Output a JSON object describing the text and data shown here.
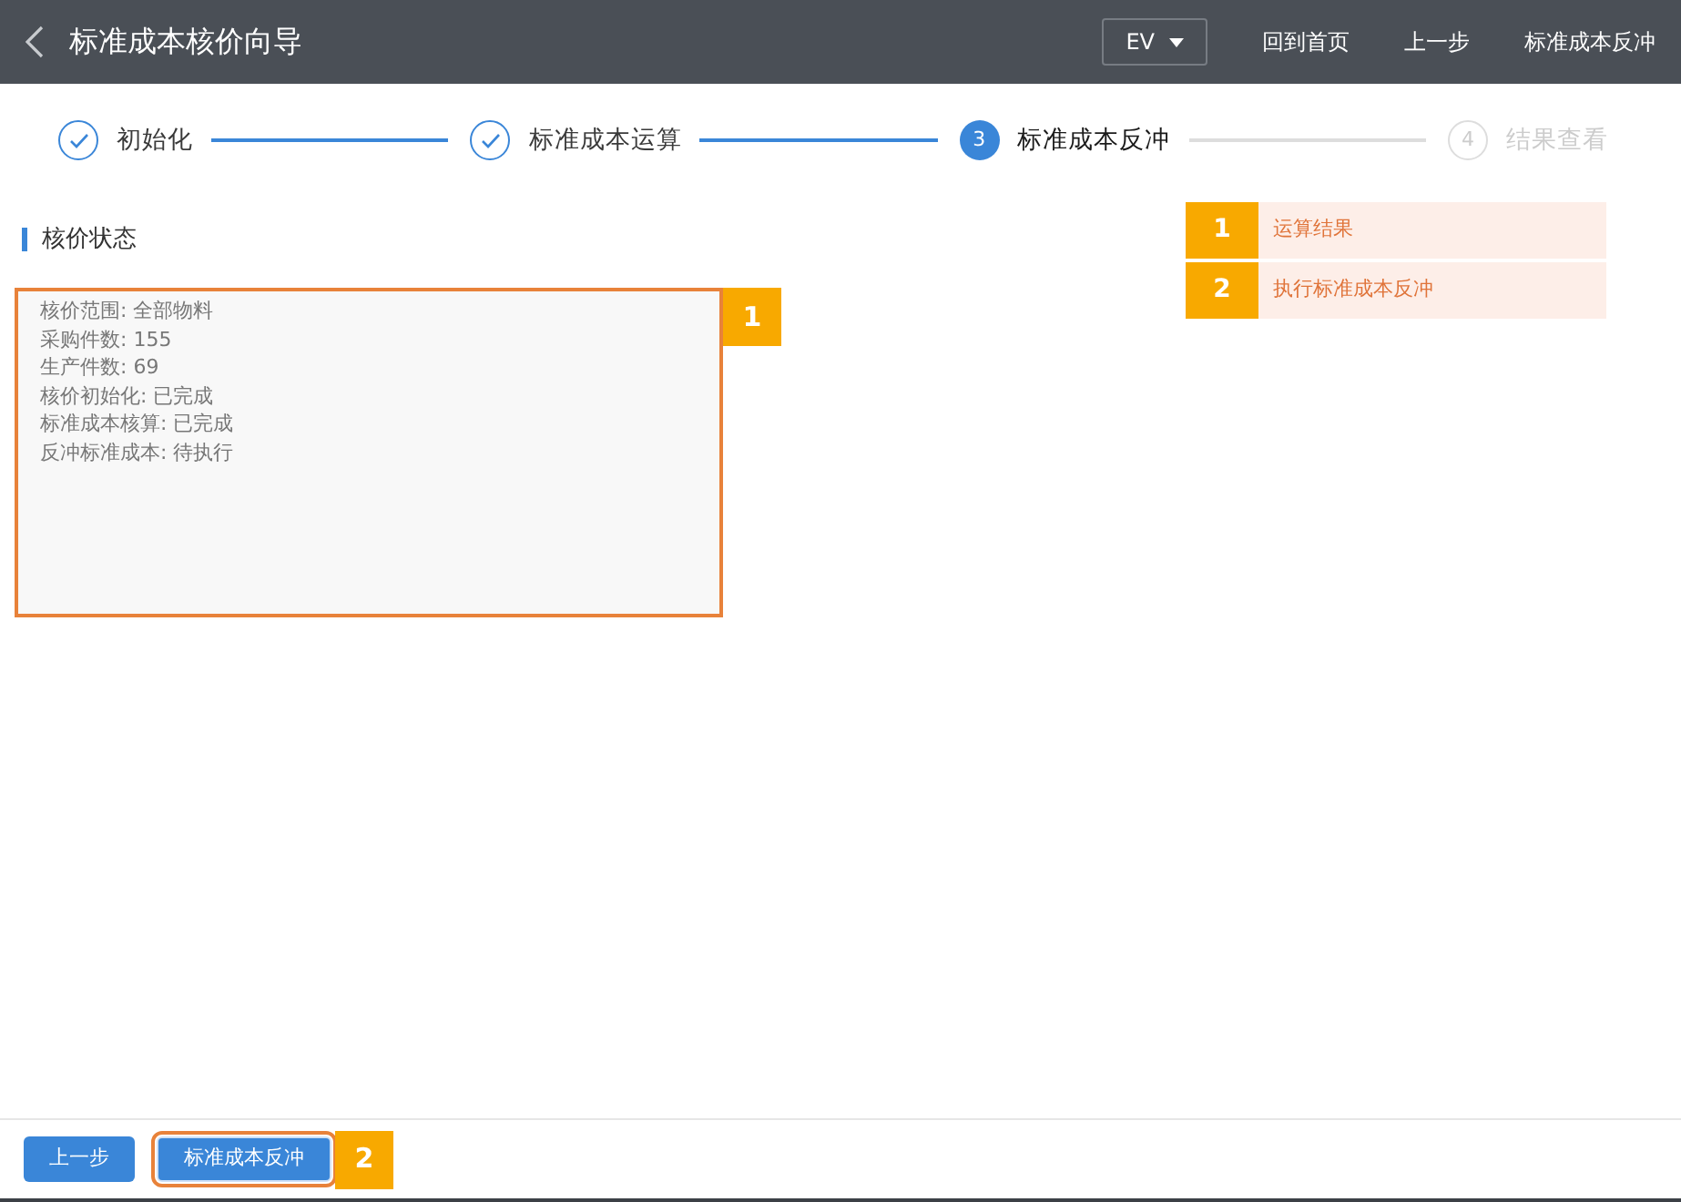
{
  "header": {
    "title": "标准成本核价向导",
    "lang_select": "EV",
    "actions": [
      "回到首页",
      "上一步",
      "标准成本反冲"
    ]
  },
  "steps": [
    {
      "label": "初始化",
      "completed": true,
      "selected": false
    },
    {
      "label": "标准成本运算",
      "completed": true,
      "selected": false
    },
    {
      "number": "3",
      "label": "标准成本反冲",
      "completed": false,
      "selected": true
    },
    {
      "number": "4",
      "label": "结果查看",
      "completed": false,
      "selected": false
    }
  ],
  "section_title": "核价状态",
  "status_box": {
    "marker": "1",
    "lines": [
      "核价范围: 全部物料",
      "采购件数: 155",
      "生产件数: 69",
      "核价初始化: 已完成",
      "标准成本核算: 已完成",
      "反冲标准成本: 待执行"
    ]
  },
  "callouts": [
    {
      "number": "1",
      "text": "运算结果"
    },
    {
      "number": "2",
      "text": "执行标准成本反冲"
    }
  ],
  "footer": {
    "buttons": [
      {
        "label": "上一步",
        "highlighted": false
      },
      {
        "label": "标准成本反冲",
        "highlighted": true,
        "marker": "2"
      }
    ]
  }
}
